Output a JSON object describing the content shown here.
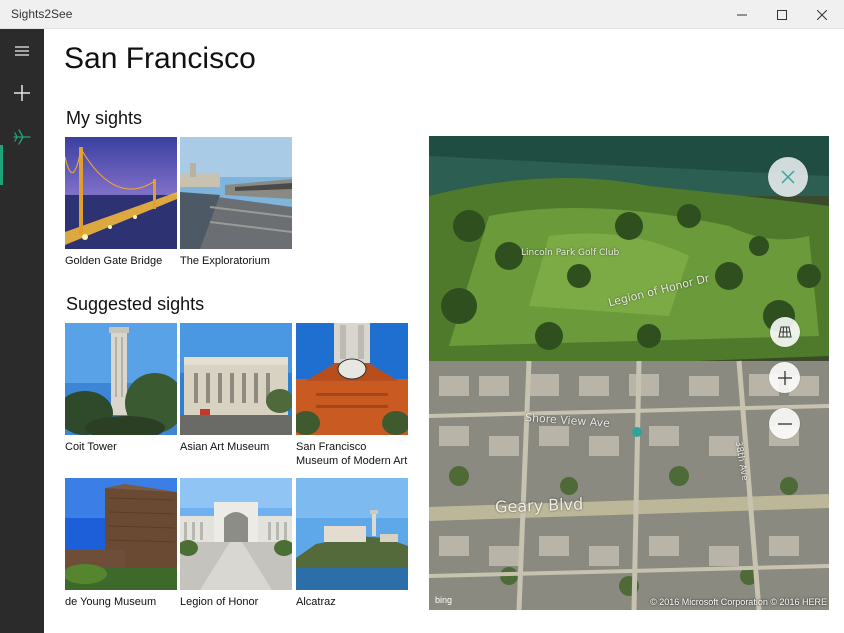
{
  "window": {
    "title": "Sights2See",
    "minimize_icon": "minimize-icon",
    "maximize_icon": "maximize-icon",
    "close_icon": "close-icon"
  },
  "nav": {
    "items": [
      {
        "icon": "hamburger-icon",
        "active": false
      },
      {
        "icon": "plus-icon",
        "active": false
      },
      {
        "icon": "airplane-icon",
        "active": true
      }
    ],
    "accent": "#1fa37a"
  },
  "page": {
    "title": "San Francisco",
    "my_sights_title": "My sights",
    "suggested_title": "Suggested sights"
  },
  "my_sights": [
    {
      "label": "Golden Gate Bridge"
    },
    {
      "label": "The Exploratorium"
    }
  ],
  "suggested_sights": [
    {
      "label": "Coit Tower"
    },
    {
      "label": "Asian Art Museum"
    },
    {
      "label": "San Francisco Museum of Modern Art"
    },
    {
      "label": "de Young Museum"
    },
    {
      "label": "Legion of Honor"
    },
    {
      "label": "Alcatraz"
    }
  ],
  "map": {
    "labels": {
      "park": "Lincoln Park Golf Club",
      "road1": "Legion of Honor Dr",
      "road2": "Shore View Ave",
      "road3": "Geary Blvd",
      "road4": "38th Ave"
    },
    "bing": "bing",
    "copyright": "© 2016 Microsoft Corporation © 2016 HERE",
    "close_icon": "close-icon",
    "layers_icon": "layers-icon",
    "zoom_in_icon": "zoom-in-icon",
    "zoom_out_icon": "zoom-out-icon"
  }
}
